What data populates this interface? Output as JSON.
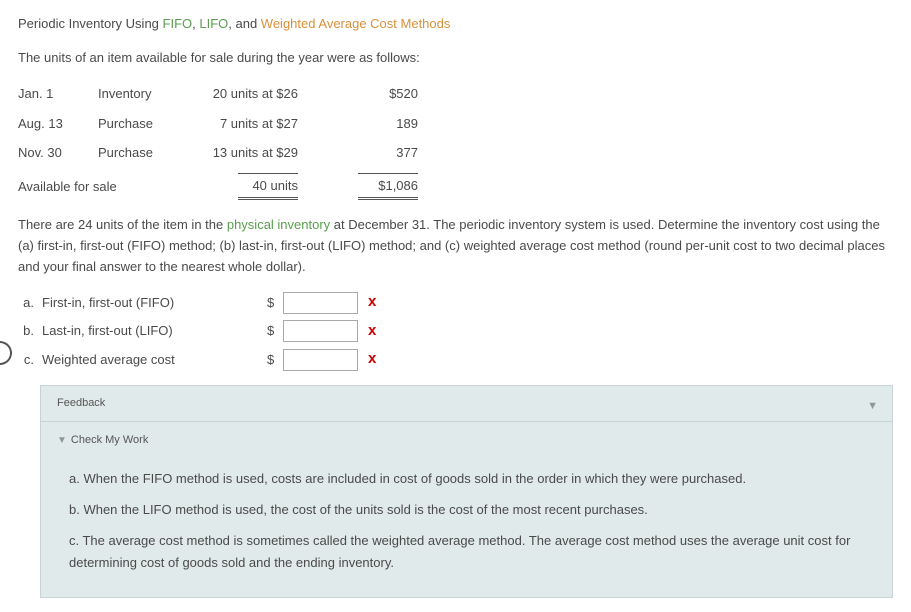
{
  "title": {
    "prefix": "Periodic Inventory Using ",
    "fifo": "FIFO",
    "sep1": ", ",
    "lifo": "LIFO",
    "sep2": ", and ",
    "wavg": "Weighted Average Cost Methods"
  },
  "intro": "The units of an item available for sale during the year were as follows:",
  "table": {
    "rows": [
      {
        "date": "Jan. 1",
        "type": "Inventory",
        "qty": "20 units at $26",
        "amt": "$520"
      },
      {
        "date": "Aug. 13",
        "type": "Purchase",
        "qty": "7 units at $27",
        "amt": "189"
      },
      {
        "date": "Nov. 30",
        "type": "Purchase",
        "qty": "13 units at $29",
        "amt": "377"
      }
    ],
    "total": {
      "label": "Available for sale",
      "qty": "40 units",
      "amt": "$1,086"
    }
  },
  "problem": {
    "p1a": "There are 24 units of the item in the ",
    "phys": "physical inventory",
    "p1b": " at December 31. The periodic inventory system is used. Determine the inventory cost using the (a) first-in, first-out (FIFO) method; (b) last-in, first-out (LIFO) method; and (c) weighted average cost method (round per-unit cost to two decimal places and your final answer to the nearest whole dollar)."
  },
  "answers": [
    {
      "letter": "a.",
      "label": "First-in, first-out (FIFO)",
      "sign": "$",
      "x": "x"
    },
    {
      "letter": "b.",
      "label": "Last-in, first-out (LIFO)",
      "sign": "$",
      "x": "x"
    },
    {
      "letter": "c.",
      "label": "Weighted average cost",
      "sign": "$",
      "x": "x"
    }
  ],
  "feedback": {
    "header": "Feedback",
    "check": "Check My Work",
    "a": "a. When the FIFO method is used, costs are included in cost of goods sold in the order in which they were purchased.",
    "b": "b. When the LIFO method is used, the cost of the units sold is the cost of the most recent purchases.",
    "c": "c. The average cost method is sometimes called the weighted average method. The average cost method uses the average unit cost for determining cost of goods sold and the ending inventory."
  }
}
